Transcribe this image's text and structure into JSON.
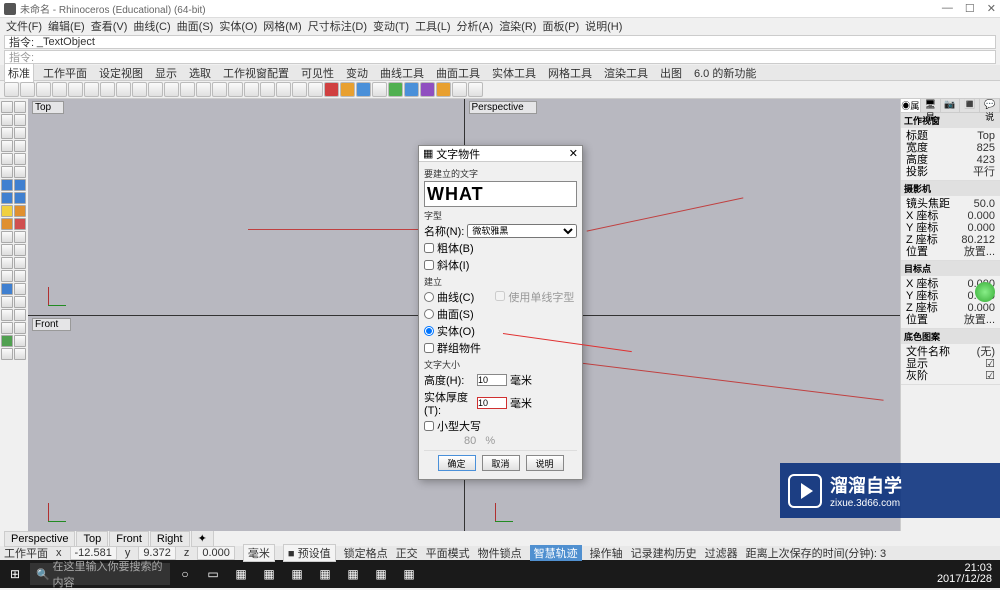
{
  "window": {
    "title": "未命名 - Rhinoceros (Educational) (64-bit)",
    "min": "—",
    "max": "☐",
    "close": "✕"
  },
  "menubar": [
    "文件(F)",
    "编辑(E)",
    "查看(V)",
    "曲线(C)",
    "曲面(S)",
    "实体(O)",
    "网格(M)",
    "尺寸标注(D)",
    "变动(T)",
    "工具(L)",
    "分析(A)",
    "渲染(R)",
    "面板(P)",
    "说明(H)"
  ],
  "command_label": "指令:",
  "command_value": "_TextObject",
  "command2_label": "指令:",
  "tabbar": [
    "标准",
    "工作平面",
    "设定视图",
    "显示",
    "选取",
    "工作视窗配置",
    "可见性",
    "变动",
    "曲线工具",
    "曲面工具",
    "实体工具",
    "网格工具",
    "渲染工具",
    "出图",
    "6.0 的新功能"
  ],
  "viewports": {
    "tl": "Top",
    "tr": "Perspective",
    "bl": "Front",
    "br": ""
  },
  "vptabs": [
    "Perspective",
    "Top",
    "Front",
    "Right",
    "✦"
  ],
  "status": {
    "coords_x_lbl": "x",
    "coords_x": "-12.581",
    "coords_y_lbl": "y",
    "coords_y": "9.372",
    "coords_z_lbl": "z",
    "coords_z": "0.000",
    "unit": "毫米",
    "layer": "■ 预设值",
    "buttons": [
      "锁定格点",
      "正交",
      "平面模式",
      "物件锁点",
      "智慧轨迹",
      "操作轴",
      "记录建构历史",
      "过滤器",
      "距离上次保存的时间(分钟): 3"
    ]
  },
  "taskbar": {
    "search_placeholder": "在这里输入你要搜索的内容",
    "time": "21:03",
    "date": "2017/12/28"
  },
  "rpanel": {
    "tabs": [
      "◉属",
      "🖥显",
      "📷",
      "🔳",
      "💬说"
    ],
    "sec1_title": "工作视窗",
    "sec1": [
      [
        "标题",
        "Top"
      ],
      [
        "宽度",
        "825"
      ],
      [
        "高度",
        "423"
      ],
      [
        "投影",
        "平行"
      ]
    ],
    "sec2_title": "摄影机",
    "sec2": [
      [
        "镜头焦距",
        "50.0"
      ],
      [
        "X 座标",
        "0.000"
      ],
      [
        "Y 座标",
        "0.000"
      ],
      [
        "Z 座标",
        "80.212"
      ],
      [
        "位置",
        "放置..."
      ]
    ],
    "sec3_title": "目标点",
    "sec3": [
      [
        "X 座标",
        "0.000"
      ],
      [
        "Y 座标",
        "0.000"
      ],
      [
        "Z 座标",
        "0.000"
      ],
      [
        "位置",
        "放置..."
      ]
    ],
    "sec4_title": "底色图案",
    "sec4": [
      [
        "文件名称",
        "(无)"
      ],
      [
        "显示",
        "☑"
      ],
      [
        "灰阶",
        "☑"
      ]
    ]
  },
  "dialog": {
    "title": "文字物件",
    "close": "✕",
    "text_label": "要建立的文字",
    "text_value": "WHAT",
    "font_section": "字型",
    "font_name_label": "名称(N):",
    "font_name": "微软雅黑",
    "bold": "粗体(B)",
    "italic": "斜体(I)",
    "create_section": "建立",
    "opt_curve": "曲线(C)",
    "opt_surface": "曲面(S)",
    "opt_solid": "实体(O)",
    "opt_group": "群组物件",
    "allow_single": "使用单线字型",
    "size_section": "文字大小",
    "height_label": "高度(H):",
    "height_value": "10",
    "height_unit": "毫米",
    "thick_label": "实体厚度(T):",
    "thick_value": "10",
    "thick_unit": "毫米",
    "small_caps": "小型大写",
    "pct": "80",
    "pct_unit": "%",
    "ok": "确定",
    "cancel": "取消",
    "help": "说明"
  },
  "watermark": {
    "name": "溜溜自学",
    "url": "zixue.3d66.com"
  }
}
